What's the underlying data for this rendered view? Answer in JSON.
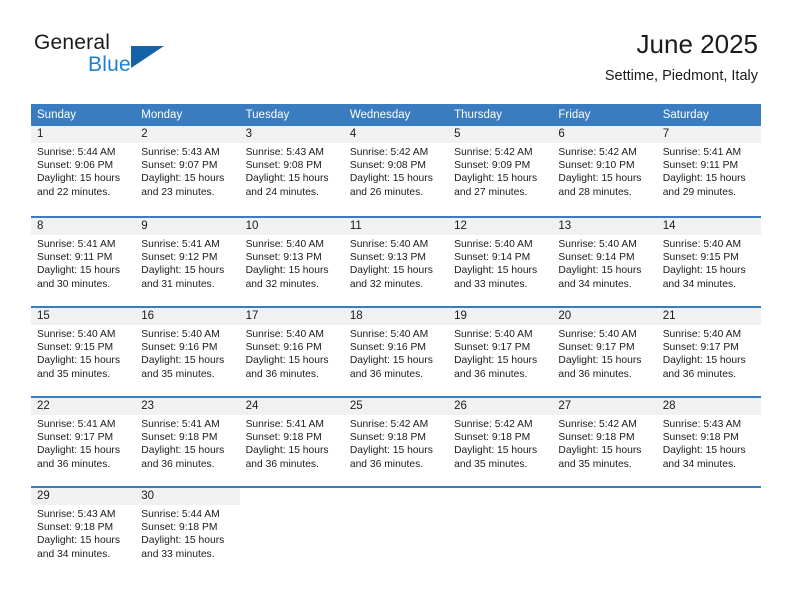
{
  "brand": {
    "line1": "General",
    "line2": "Blue",
    "triangle_color": "#1463a8",
    "blue_color": "#1f7fd0"
  },
  "header": {
    "title": "June 2025",
    "subtitle": "Settime, Piedmont, Italy"
  },
  "theme": {
    "header_row_bg": "#3a7cc0",
    "daynum_bg": "#f1f1f1",
    "text": "#1b1b1b"
  },
  "weekdays": [
    "Sunday",
    "Monday",
    "Tuesday",
    "Wednesday",
    "Thursday",
    "Friday",
    "Saturday"
  ],
  "days": [
    {
      "n": "1",
      "sunrise": "Sunrise: 5:44 AM",
      "sunset": "Sunset: 9:06 PM",
      "dl1": "Daylight: 15 hours",
      "dl2": "and 22 minutes."
    },
    {
      "n": "2",
      "sunrise": "Sunrise: 5:43 AM",
      "sunset": "Sunset: 9:07 PM",
      "dl1": "Daylight: 15 hours",
      "dl2": "and 23 minutes."
    },
    {
      "n": "3",
      "sunrise": "Sunrise: 5:43 AM",
      "sunset": "Sunset: 9:08 PM",
      "dl1": "Daylight: 15 hours",
      "dl2": "and 24 minutes."
    },
    {
      "n": "4",
      "sunrise": "Sunrise: 5:42 AM",
      "sunset": "Sunset: 9:08 PM",
      "dl1": "Daylight: 15 hours",
      "dl2": "and 26 minutes."
    },
    {
      "n": "5",
      "sunrise": "Sunrise: 5:42 AM",
      "sunset": "Sunset: 9:09 PM",
      "dl1": "Daylight: 15 hours",
      "dl2": "and 27 minutes."
    },
    {
      "n": "6",
      "sunrise": "Sunrise: 5:42 AM",
      "sunset": "Sunset: 9:10 PM",
      "dl1": "Daylight: 15 hours",
      "dl2": "and 28 minutes."
    },
    {
      "n": "7",
      "sunrise": "Sunrise: 5:41 AM",
      "sunset": "Sunset: 9:11 PM",
      "dl1": "Daylight: 15 hours",
      "dl2": "and 29 minutes."
    },
    {
      "n": "8",
      "sunrise": "Sunrise: 5:41 AM",
      "sunset": "Sunset: 9:11 PM",
      "dl1": "Daylight: 15 hours",
      "dl2": "and 30 minutes."
    },
    {
      "n": "9",
      "sunrise": "Sunrise: 5:41 AM",
      "sunset": "Sunset: 9:12 PM",
      "dl1": "Daylight: 15 hours",
      "dl2": "and 31 minutes."
    },
    {
      "n": "10",
      "sunrise": "Sunrise: 5:40 AM",
      "sunset": "Sunset: 9:13 PM",
      "dl1": "Daylight: 15 hours",
      "dl2": "and 32 minutes."
    },
    {
      "n": "11",
      "sunrise": "Sunrise: 5:40 AM",
      "sunset": "Sunset: 9:13 PM",
      "dl1": "Daylight: 15 hours",
      "dl2": "and 32 minutes."
    },
    {
      "n": "12",
      "sunrise": "Sunrise: 5:40 AM",
      "sunset": "Sunset: 9:14 PM",
      "dl1": "Daylight: 15 hours",
      "dl2": "and 33 minutes."
    },
    {
      "n": "13",
      "sunrise": "Sunrise: 5:40 AM",
      "sunset": "Sunset: 9:14 PM",
      "dl1": "Daylight: 15 hours",
      "dl2": "and 34 minutes."
    },
    {
      "n": "14",
      "sunrise": "Sunrise: 5:40 AM",
      "sunset": "Sunset: 9:15 PM",
      "dl1": "Daylight: 15 hours",
      "dl2": "and 34 minutes."
    },
    {
      "n": "15",
      "sunrise": "Sunrise: 5:40 AM",
      "sunset": "Sunset: 9:15 PM",
      "dl1": "Daylight: 15 hours",
      "dl2": "and 35 minutes."
    },
    {
      "n": "16",
      "sunrise": "Sunrise: 5:40 AM",
      "sunset": "Sunset: 9:16 PM",
      "dl1": "Daylight: 15 hours",
      "dl2": "and 35 minutes."
    },
    {
      "n": "17",
      "sunrise": "Sunrise: 5:40 AM",
      "sunset": "Sunset: 9:16 PM",
      "dl1": "Daylight: 15 hours",
      "dl2": "and 36 minutes."
    },
    {
      "n": "18",
      "sunrise": "Sunrise: 5:40 AM",
      "sunset": "Sunset: 9:16 PM",
      "dl1": "Daylight: 15 hours",
      "dl2": "and 36 minutes."
    },
    {
      "n": "19",
      "sunrise": "Sunrise: 5:40 AM",
      "sunset": "Sunset: 9:17 PM",
      "dl1": "Daylight: 15 hours",
      "dl2": "and 36 minutes."
    },
    {
      "n": "20",
      "sunrise": "Sunrise: 5:40 AM",
      "sunset": "Sunset: 9:17 PM",
      "dl1": "Daylight: 15 hours",
      "dl2": "and 36 minutes."
    },
    {
      "n": "21",
      "sunrise": "Sunrise: 5:40 AM",
      "sunset": "Sunset: 9:17 PM",
      "dl1": "Daylight: 15 hours",
      "dl2": "and 36 minutes."
    },
    {
      "n": "22",
      "sunrise": "Sunrise: 5:41 AM",
      "sunset": "Sunset: 9:17 PM",
      "dl1": "Daylight: 15 hours",
      "dl2": "and 36 minutes."
    },
    {
      "n": "23",
      "sunrise": "Sunrise: 5:41 AM",
      "sunset": "Sunset: 9:18 PM",
      "dl1": "Daylight: 15 hours",
      "dl2": "and 36 minutes."
    },
    {
      "n": "24",
      "sunrise": "Sunrise: 5:41 AM",
      "sunset": "Sunset: 9:18 PM",
      "dl1": "Daylight: 15 hours",
      "dl2": "and 36 minutes."
    },
    {
      "n": "25",
      "sunrise": "Sunrise: 5:42 AM",
      "sunset": "Sunset: 9:18 PM",
      "dl1": "Daylight: 15 hours",
      "dl2": "and 36 minutes."
    },
    {
      "n": "26",
      "sunrise": "Sunrise: 5:42 AM",
      "sunset": "Sunset: 9:18 PM",
      "dl1": "Daylight: 15 hours",
      "dl2": "and 35 minutes."
    },
    {
      "n": "27",
      "sunrise": "Sunrise: 5:42 AM",
      "sunset": "Sunset: 9:18 PM",
      "dl1": "Daylight: 15 hours",
      "dl2": "and 35 minutes."
    },
    {
      "n": "28",
      "sunrise": "Sunrise: 5:43 AM",
      "sunset": "Sunset: 9:18 PM",
      "dl1": "Daylight: 15 hours",
      "dl2": "and 34 minutes."
    },
    {
      "n": "29",
      "sunrise": "Sunrise: 5:43 AM",
      "sunset": "Sunset: 9:18 PM",
      "dl1": "Daylight: 15 hours",
      "dl2": "and 34 minutes."
    },
    {
      "n": "30",
      "sunrise": "Sunrise: 5:44 AM",
      "sunset": "Sunset: 9:18 PM",
      "dl1": "Daylight: 15 hours",
      "dl2": "and 33 minutes."
    }
  ],
  "grid": {
    "first_day_column_index": 0,
    "rows": 5,
    "columns": 7
  }
}
